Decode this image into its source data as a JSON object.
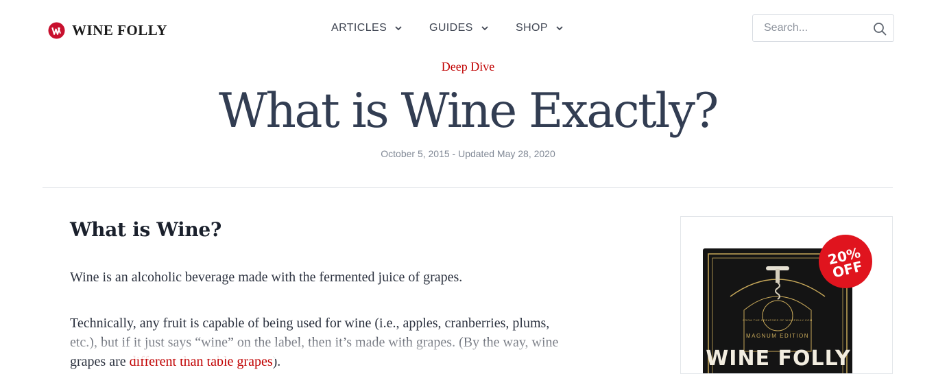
{
  "header": {
    "logo_text": "WINE FOLLY",
    "nav": [
      {
        "label": "ARTICLES"
      },
      {
        "label": "GUIDES"
      },
      {
        "label": "SHOP"
      }
    ],
    "search_placeholder": "Search..."
  },
  "hero": {
    "kicker": "Deep Dive",
    "title": "What is Wine Exactly?",
    "dateline": "October 5, 2015 - Updated May 28, 2020"
  },
  "article": {
    "heading": "What is Wine?",
    "p1": "Wine is an alcoholic beverage made with the fermented juice of grapes.",
    "p2_text": "Technically, any fruit is capable of being used for wine (i.e., apples, cranberries, plums, etc.), but if it just says “wine” on the label, then it’s made with grapes. (By the way, wine grapes are different than table grapes).",
    "p2_link": "different than table grapes"
  },
  "sidebar": {
    "badge_line1": "20%",
    "badge_line2": "OFF",
    "book_title": "WINE FOLLY",
    "book_edition": "MAGNUM EDITION",
    "book_small": "FROM THE CREATORS OF WINEFOLLY.COM"
  },
  "colors": {
    "accent_red": "#c00000",
    "title_slate": "#323d52",
    "badge_red": "#e0141e",
    "book_black": "#141414",
    "book_gold": "#c8a95a"
  },
  "icons": [
    "wine-folly-logo-icon",
    "chevron-down-icon",
    "search-icon"
  ]
}
